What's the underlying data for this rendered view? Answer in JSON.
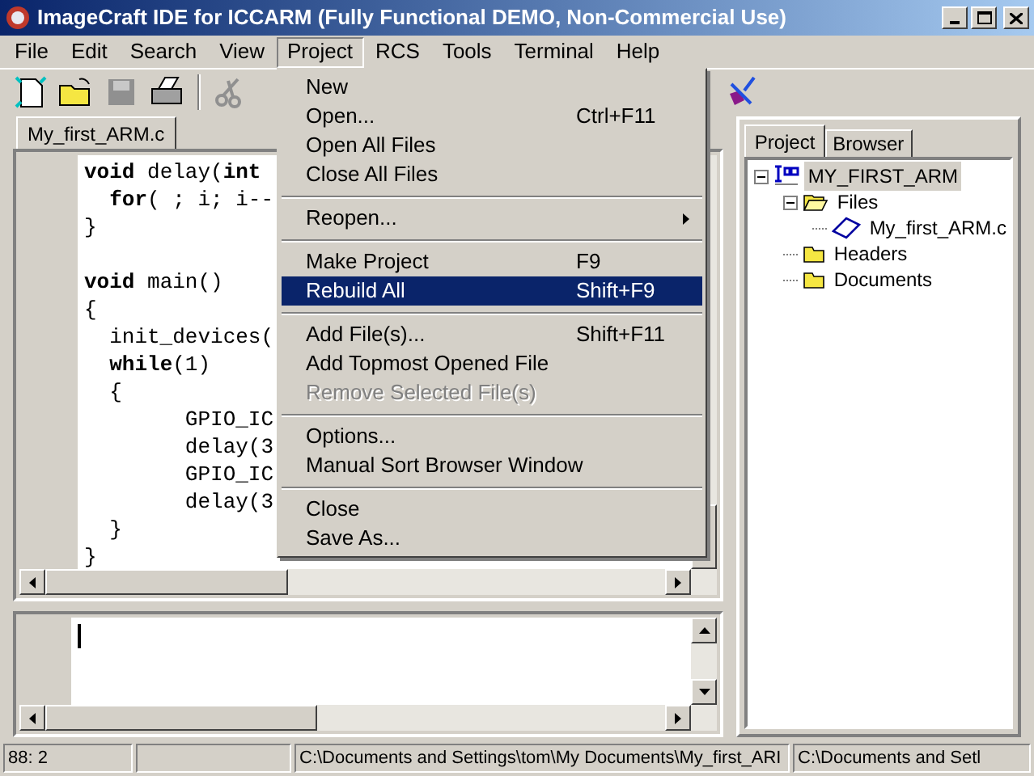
{
  "window": {
    "title": "ImageCraft IDE for ICCARM (Fully Functional DEMO, Non-Commercial Use)"
  },
  "menu_bar": [
    {
      "label": "File",
      "selected": false
    },
    {
      "label": "Edit",
      "selected": false
    },
    {
      "label": "Search",
      "selected": false
    },
    {
      "label": "View",
      "selected": false
    },
    {
      "label": "Project",
      "selected": true
    },
    {
      "label": "RCS",
      "selected": false
    },
    {
      "label": "Tools",
      "selected": false
    },
    {
      "label": "Terminal",
      "selected": false
    },
    {
      "label": "Help",
      "selected": false
    }
  ],
  "editor": {
    "tab": "My_first_ARM.c",
    "blocks": [
      [
        "**void** delay(**int**",
        "  **for**( ; i; i--",
        "}"
      ],
      [
        "**void** main()",
        "{",
        "  init_devices(",
        "  **while**(1)",
        "  {",
        "        GPIO_IC",
        "        delay(3",
        "        GPIO_IC",
        "        delay(3",
        "  }",
        "}"
      ]
    ]
  },
  "project_menu": [
    {
      "kind": "item",
      "label": "New",
      "selected": false,
      "disabled": false
    },
    {
      "kind": "item",
      "label": "Open...",
      "shortcut": "Ctrl+F11",
      "selected": false,
      "disabled": false
    },
    {
      "kind": "item",
      "label": "Open All Files",
      "selected": false,
      "disabled": false
    },
    {
      "kind": "item",
      "label": "Close All Files",
      "selected": false,
      "disabled": false
    },
    {
      "kind": "separator"
    },
    {
      "kind": "submenu",
      "label": "Reopen...",
      "selected": false,
      "disabled": false
    },
    {
      "kind": "separator"
    },
    {
      "kind": "item",
      "label": "Make Project",
      "shortcut": "F9",
      "selected": false,
      "disabled": false
    },
    {
      "kind": "item",
      "label": "Rebuild All",
      "shortcut": "Shift+F9",
      "selected": true,
      "disabled": false
    },
    {
      "kind": "separator"
    },
    {
      "kind": "item",
      "label": "Add File(s)...",
      "shortcut": "Shift+F11",
      "selected": false,
      "disabled": false
    },
    {
      "kind": "item",
      "label": "Add Topmost Opened File",
      "selected": false,
      "disabled": false
    },
    {
      "kind": "item",
      "label": "Remove Selected File(s)",
      "selected": false,
      "disabled": true
    },
    {
      "kind": "separator"
    },
    {
      "kind": "item",
      "label": "Options...",
      "selected": false,
      "disabled": false
    },
    {
      "kind": "item",
      "label": "Manual Sort Browser Window",
      "selected": false,
      "disabled": false
    },
    {
      "kind": "separator"
    },
    {
      "kind": "item",
      "label": "Close",
      "selected": false,
      "disabled": false
    },
    {
      "kind": "item",
      "label": "Save As...",
      "selected": false,
      "disabled": false
    }
  ],
  "side_tabs": [
    {
      "label": "Project",
      "selected": true
    },
    {
      "label": "Browser",
      "selected": false
    }
  ],
  "project_tree": [
    {
      "kind": "project",
      "label": "MY_FIRST_ARM",
      "selected": true,
      "expanded": true,
      "children": [
        {
          "kind": "folder",
          "label": "Files",
          "selected": false,
          "expanded": true,
          "children": [
            {
              "kind": "file",
              "label": "My_first_ARM.c",
              "selected": false
            }
          ]
        },
        {
          "kind": "folder",
          "label": "Headers",
          "selected": false
        },
        {
          "kind": "folder",
          "label": "Documents",
          "selected": false
        }
      ]
    }
  ],
  "status_bar": {
    "cursor": "88: 2",
    "paths": [
      "C:\\Documents and Settings\\tom\\My Documents\\My_first_ARI",
      "C:\\Documents and Setl"
    ]
  }
}
